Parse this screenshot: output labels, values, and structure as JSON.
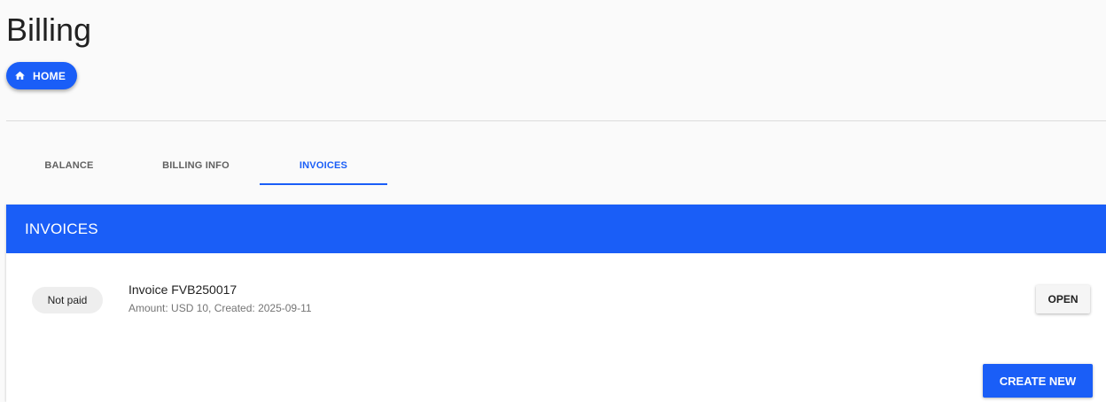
{
  "page": {
    "title": "Billing"
  },
  "breadcrumb": {
    "home_label": "HOME",
    "home_icon": "home-icon"
  },
  "tabs": [
    {
      "label": "BALANCE",
      "active": false
    },
    {
      "label": "BILLING INFO",
      "active": false
    },
    {
      "label": "INVOICES",
      "active": true
    }
  ],
  "invoices_card": {
    "header": "INVOICES",
    "items": [
      {
        "status": "Not paid",
        "title": "Invoice FVB250017",
        "subtitle": "Amount: USD 10, Created: 2025-09-11",
        "action_label": "OPEN"
      }
    ],
    "create_label": "CREATE NEW"
  },
  "colors": {
    "accent": "#1a5ef7",
    "background": "#fafafa",
    "chip_background": "#eeeeee"
  }
}
